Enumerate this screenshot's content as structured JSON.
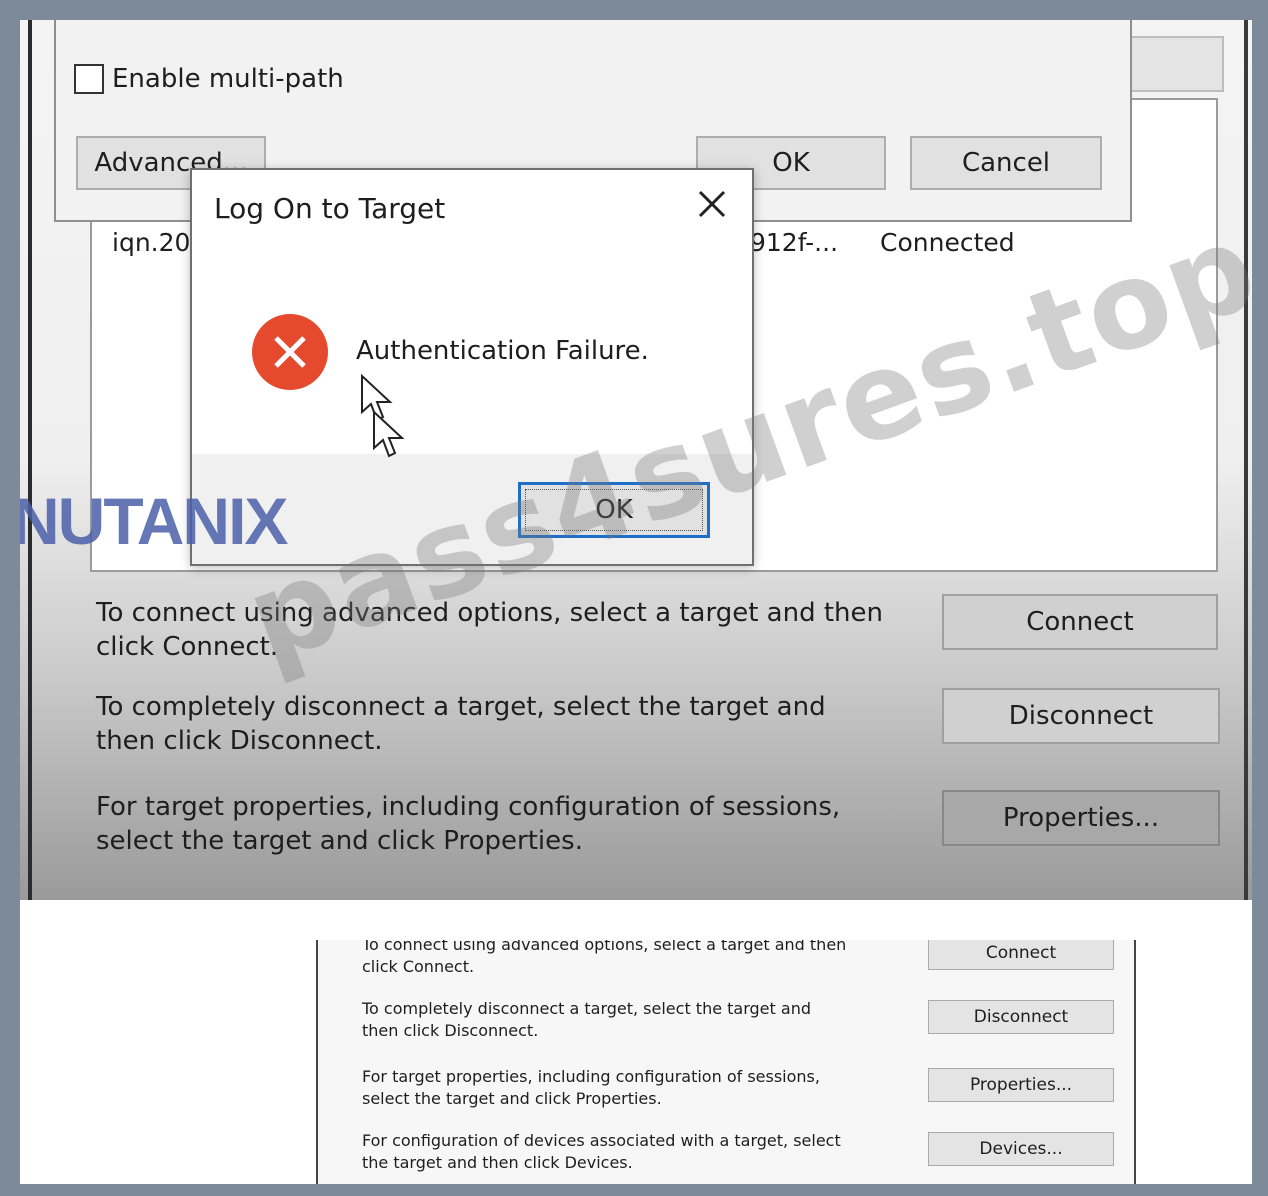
{
  "advanced_dialog": {
    "multipath_label": "Enable multi-path",
    "advanced_label": "Advanced...",
    "ok_label": "OK",
    "cancel_label": "Cancel"
  },
  "targets_list": {
    "row": {
      "name": "iqn.20",
      "id_fragment": "912f-...",
      "status": "Connected"
    }
  },
  "logon_dialog": {
    "title": "Log On to Target",
    "message": "Authentication Failure.",
    "ok_label": "OK",
    "error_color": "#e64a2e"
  },
  "main": {
    "connect_text": [
      "To connect using advanced options, select a target and then",
      "click Connect."
    ],
    "disconnect_text": [
      "To completely disconnect a target, select the target and",
      "then click Disconnect."
    ],
    "properties_text": [
      "For target properties, including configuration of sessions,",
      "select the target and click Properties."
    ],
    "connect_label": "Connect",
    "disconnect_label": "Disconnect",
    "properties_label": "Properties..."
  },
  "lower_panel": {
    "connect_text": [
      "To connect using advanced options, select a target and then",
      "click Connect."
    ],
    "disconnect_text": [
      "To completely disconnect a target, select the target and",
      "then click Disconnect."
    ],
    "properties_text": [
      "For target properties, including configuration of sessions,",
      "select the target and click Properties."
    ],
    "devices_text": [
      "For configuration of devices associated with a target, select",
      "the target and then click Devices."
    ],
    "connect_label": "Connect",
    "disconnect_label": "Disconnect",
    "properties_label": "Properties...",
    "devices_label": "Devices..."
  },
  "watermarks": {
    "logo_text": "NUTANIX",
    "site_text": "pass4sures.top"
  }
}
